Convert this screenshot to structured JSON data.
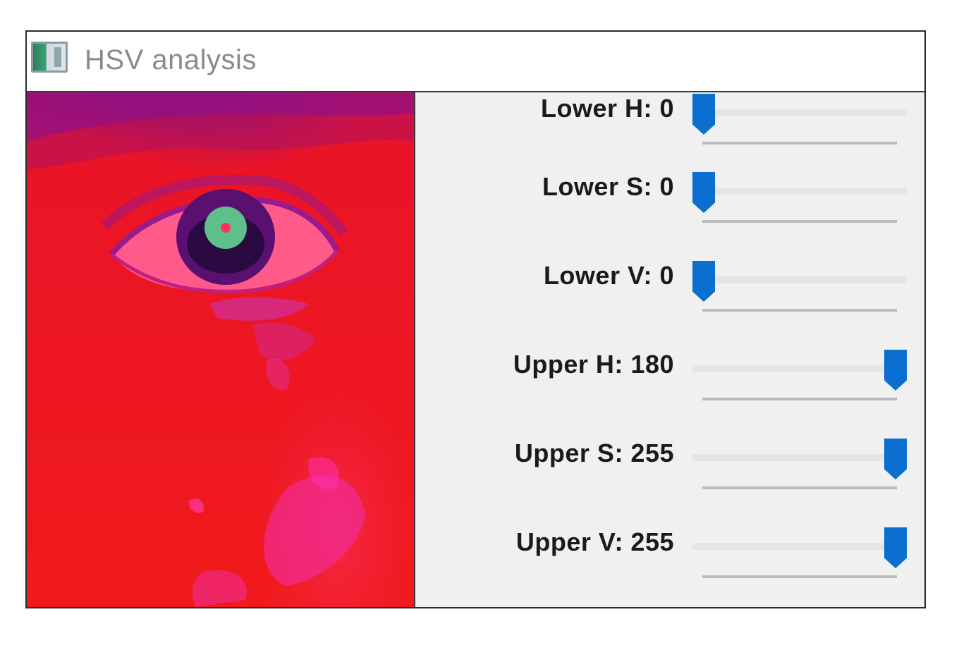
{
  "window": {
    "title": "HSV analysis",
    "icon": "app-window-icon"
  },
  "image": {
    "description_icon": "hsv-image-preview"
  },
  "sliders": [
    {
      "label": "Lower H: 0",
      "value": 0,
      "max": 180
    },
    {
      "label": "Lower S: 0",
      "value": 0,
      "max": 255
    },
    {
      "label": "Lower V: 0",
      "value": 0,
      "max": 255
    },
    {
      "label": "Upper H: 180",
      "value": 180,
      "max": 180
    },
    {
      "label": "Upper S: 255",
      "value": 255,
      "max": 255
    },
    {
      "label": "Upper V: 255",
      "value": 255,
      "max": 255
    }
  ],
  "colors": {
    "thumb": "#0a6fd1",
    "image_base": "#ec1525"
  }
}
